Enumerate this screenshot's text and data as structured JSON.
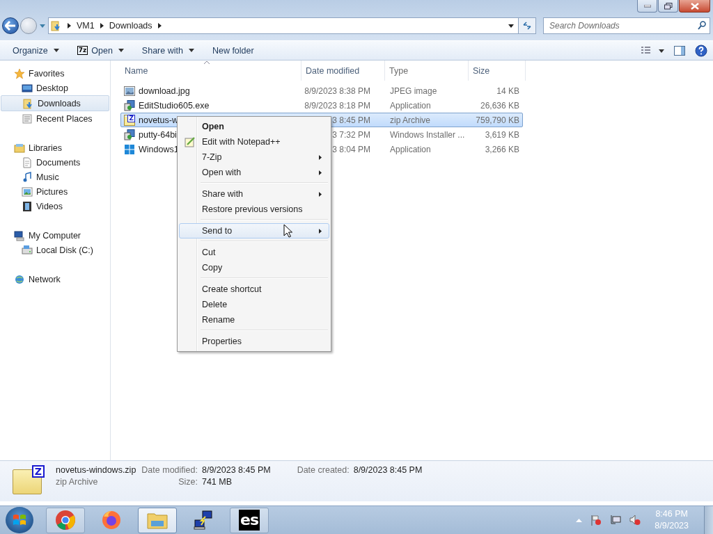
{
  "address": {
    "crumbs": [
      "VM1",
      "Downloads"
    ]
  },
  "search": {
    "placeholder": "Search Downloads"
  },
  "toolbar": [
    {
      "label": "Organize",
      "kind": "menu"
    },
    {
      "label": "Open",
      "kind": "menu",
      "badge": "7z"
    },
    {
      "label": "Share with",
      "kind": "menu"
    },
    {
      "label": "New folder",
      "kind": "button"
    }
  ],
  "nav": [
    {
      "label": "Favorites",
      "kind": "star",
      "selected": false,
      "children": [
        {
          "label": "Desktop",
          "kind": "desktop",
          "selected": false
        },
        {
          "label": "Downloads",
          "kind": "downloads",
          "selected": true
        },
        {
          "label": "Recent Places",
          "kind": "recent",
          "selected": false
        }
      ]
    },
    {
      "label": "Libraries",
      "kind": "library",
      "selected": false,
      "children": [
        {
          "label": "Documents",
          "kind": "document",
          "selected": false
        },
        {
          "label": "Music",
          "kind": "music",
          "selected": false
        },
        {
          "label": "Pictures",
          "kind": "pictures",
          "selected": false
        },
        {
          "label": "Videos",
          "kind": "videos",
          "selected": false
        }
      ]
    },
    {
      "label": "My Computer",
      "kind": "computer",
      "selected": false,
      "children": [
        {
          "label": "Local Disk (C:)",
          "kind": "disk",
          "selected": false
        }
      ]
    },
    {
      "label": "Network",
      "kind": "network",
      "selected": false
    }
  ],
  "columns": [
    {
      "label": "Name",
      "sorted": true
    },
    {
      "label": "Date modified",
      "sorted": false
    },
    {
      "label": "Type",
      "sorted": false
    },
    {
      "label": "Size",
      "sorted": false
    }
  ],
  "files": [
    {
      "name": "download.jpg",
      "kind": "image",
      "date": "8/9/2023 8:38 PM",
      "type": "JPEG image",
      "size": "14 KB",
      "selected": false
    },
    {
      "name": "EditStudio605.exe",
      "kind": "setup",
      "date": "8/9/2023 8:18 PM",
      "type": "Application",
      "size": "26,636 KB",
      "selected": false
    },
    {
      "name": "novetus-w",
      "kind": "zip",
      "badge": "Z",
      "date": "3 8:45 PM",
      "type": "zip Archive",
      "size": "759,790 KB",
      "selected": true
    },
    {
      "name": "putty-64bi",
      "kind": "setup",
      "date": "3 7:32 PM",
      "type": "Windows Installer ...",
      "size": "3,619 KB",
      "selected": false
    },
    {
      "name": "Windows1",
      "kind": "windows",
      "date": "3 8:04 PM",
      "type": "Application",
      "size": "3,266 KB",
      "selected": false
    }
  ],
  "menu": [
    {
      "kind": "item",
      "label": "Open",
      "default": true,
      "submenu": false,
      "selected": false
    },
    {
      "kind": "item",
      "label": "Edit with Notepad++",
      "default": false,
      "submenu": false,
      "selected": false
    },
    {
      "kind": "item",
      "label": "7-Zip",
      "default": false,
      "submenu": true,
      "selected": false
    },
    {
      "kind": "item",
      "label": "Open with",
      "default": false,
      "submenu": true,
      "selected": false
    },
    {
      "kind": "separator"
    },
    {
      "kind": "item",
      "label": "Share with",
      "default": false,
      "submenu": true,
      "selected": false
    },
    {
      "kind": "item",
      "label": "Restore previous versions",
      "default": false,
      "submenu": false,
      "selected": false
    },
    {
      "kind": "separator"
    },
    {
      "kind": "item",
      "label": "Send to",
      "default": false,
      "submenu": true,
      "selected": true
    },
    {
      "kind": "separator"
    },
    {
      "kind": "item",
      "label": "Cut",
      "default": false,
      "submenu": false,
      "selected": false
    },
    {
      "kind": "item",
      "label": "Copy",
      "default": false,
      "submenu": false,
      "selected": false
    },
    {
      "kind": "separator"
    },
    {
      "kind": "item",
      "label": "Create shortcut",
      "default": false,
      "submenu": false,
      "selected": false
    },
    {
      "kind": "item",
      "label": "Delete",
      "default": false,
      "submenu": false,
      "selected": false
    },
    {
      "kind": "item",
      "label": "Rename",
      "default": false,
      "submenu": false,
      "selected": false
    },
    {
      "kind": "separator"
    },
    {
      "kind": "item",
      "label": "Properties",
      "default": false,
      "submenu": false,
      "selected": false
    }
  ],
  "details": {
    "name": "novetus-windows.zip",
    "type": "zip Archive",
    "badge": "Z",
    "groups": [
      [
        {
          "label": "Date modified:",
          "value": "8/9/2023 8:45 PM"
        },
        {
          "label": "Size:",
          "value": "741 MB"
        }
      ],
      [
        {
          "label": "Date created:",
          "value": "8/9/2023 8:45 PM"
        }
      ]
    ]
  },
  "taskbar": {
    "apps": [
      {
        "kind": "chrome",
        "running": true,
        "active": false
      },
      {
        "kind": "firefox",
        "running": false,
        "active": false
      },
      {
        "kind": "explorer",
        "running": true,
        "active": true
      },
      {
        "kind": "putty",
        "running": false,
        "active": false
      },
      {
        "kind": "es",
        "label": "es",
        "running": true,
        "active": false
      }
    ],
    "clock": {
      "time": "8:46 PM",
      "date": "8/9/2023"
    }
  }
}
